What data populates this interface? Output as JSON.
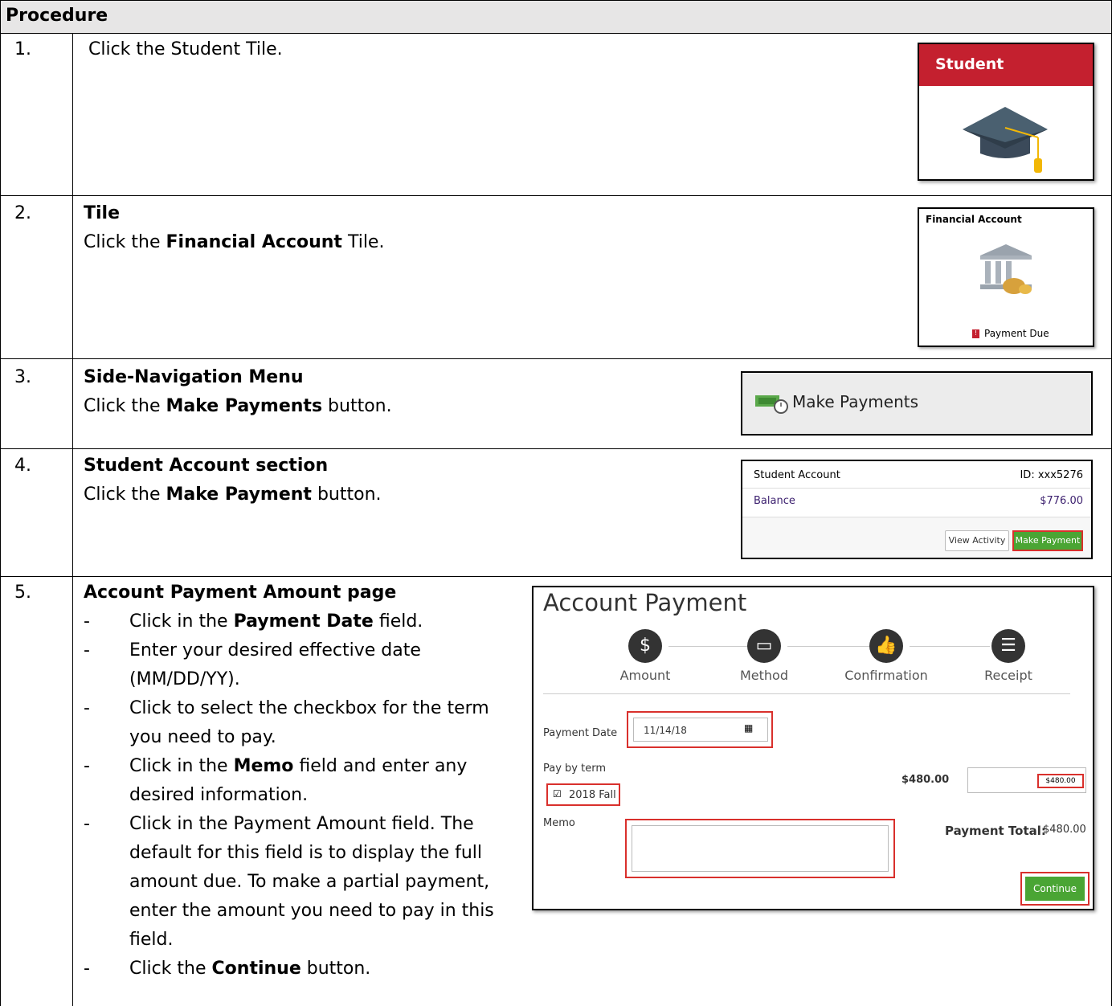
{
  "header": {
    "title": "Procedure"
  },
  "steps": [
    {
      "num": "1.",
      "line1": "Click the Student Tile."
    },
    {
      "num": "2.",
      "heading": "Tile",
      "pre": "Click the ",
      "bold": "Financial Account",
      "post": " Tile."
    },
    {
      "num": "3.",
      "heading": "Side-Navigation Menu",
      "pre": "Click the ",
      "bold": "Make Payments",
      "post": " button."
    },
    {
      "num": "4.",
      "heading": "Student Account section",
      "pre": "Click the ",
      "bold": "Make Payment",
      "post": " button."
    },
    {
      "num": "5.",
      "heading": "Account Payment Amount page"
    }
  ],
  "step5_items": {
    "i1_pre": "Click in the ",
    "i1_bold": "Payment Date",
    "i1_post": " field.",
    "i2": "Enter your desired effective date (MM/DD/YY).",
    "i3": "Click to select the checkbox for the term you need to pay.",
    "i4_pre": "Click in the ",
    "i4_bold": "Memo",
    "i4_post": " field and enter any desired information.",
    "i5": "Click in the Payment Amount field. The default for this field is to display the full amount due. To make a partial payment, enter the amount you need to pay in this field.",
    "i6_pre": "Click the ",
    "i6_bold": "Continue",
    "i6_post": " button."
  },
  "student_tile": {
    "title": "Student"
  },
  "financial_tile": {
    "title": "Financial Account",
    "status": "Payment Due"
  },
  "make_payments": {
    "label": "Make Payments"
  },
  "student_account": {
    "title": "Student Account",
    "id": "ID: xxx5276",
    "balance_label": "Balance",
    "balance_value": "$776.00",
    "view_activity": "View Activity",
    "make_payment": "Make Payment"
  },
  "account_payment": {
    "title": "Account Payment",
    "steps": [
      "Amount",
      "Method",
      "Confirmation",
      "Receipt"
    ],
    "payment_date_label": "Payment Date",
    "payment_date_value": "11/14/18",
    "pay_by_term_label": "Pay by term",
    "term_label": "2018 Fall",
    "term_amount": "$480.00",
    "term_input_value": "$480.00",
    "memo_label": "Memo",
    "payment_total_label": "Payment Total:",
    "payment_total_value": "$480.00",
    "continue_label": "Continue"
  },
  "colors": {
    "accent_red": "#d9302c",
    "tile_red": "#c4202f",
    "continue_green": "#4aa534",
    "header_gray": "#e7e6e6"
  },
  "icons": [
    "graduation-cap-icon",
    "bank-icon",
    "money-icon",
    "calendar-icon",
    "dollar-icon",
    "credit-card-icon",
    "thumbs-up-icon",
    "list-icon",
    "checkbox-icon"
  ]
}
